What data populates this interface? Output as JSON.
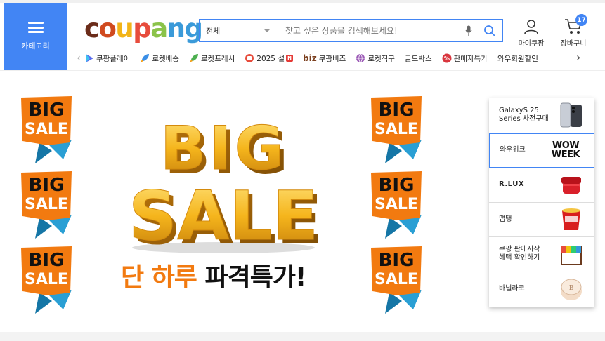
{
  "header": {
    "category_label": "카테고리",
    "logo": {
      "letters": [
        "c",
        "o",
        "u",
        "p",
        "a",
        "n",
        "g"
      ],
      "colors": [
        "#6b2c1a",
        "#d04a1f",
        "#f2b418",
        "#e74c3c",
        "#8bc34a",
        "#3a9ad9",
        "#3a9ad9"
      ]
    },
    "search": {
      "category": "전체",
      "placeholder": "찾고 싶은 상품을 검색해보세요!"
    },
    "my_coupang": "마이쿠팡",
    "cart": {
      "label": "장바구니",
      "count": "17"
    }
  },
  "nav": {
    "items": [
      {
        "label": "쿠팡플레이",
        "icon": "play-icon"
      },
      {
        "label": "로켓배송",
        "icon": "rocket-icon"
      },
      {
        "label": "로켓프레시",
        "icon": "fresh-rocket-icon"
      },
      {
        "label": "2025 설",
        "icon": "gift-icon",
        "badge": "N"
      },
      {
        "label": "쿠팡비즈",
        "icon": "biz-icon",
        "prefix": "biz"
      },
      {
        "label": "로켓직구",
        "icon": "globe-icon"
      },
      {
        "label": "골드박스",
        "icon": ""
      },
      {
        "label": "판매자특가",
        "icon": "percent-icon"
      },
      {
        "label": "와우회원할인",
        "icon": ""
      }
    ]
  },
  "banner": {
    "badge_text_1": "BIG",
    "badge_text_2": "SALE",
    "hero_top": "BIG",
    "hero_bottom": "SALE",
    "headline_orange": "단 하루",
    "headline_black": "파격특가!"
  },
  "side_panel": {
    "items": [
      {
        "label": "GalaxyS 25\nSeries 사전구매",
        "thumb": "phone-thumb"
      },
      {
        "label": "와우위크",
        "thumb": "wow-week-thumb",
        "thumb_text": "WOW\nWEEK"
      },
      {
        "label": "R.LUX",
        "thumb": "cosmetic-jar-thumb"
      },
      {
        "label": "맵탱",
        "thumb": "ramen-cup-thumb"
      },
      {
        "label": "쿠팡 판매시작\n혜택 확인하기",
        "thumb": "store-thumb"
      },
      {
        "label": "바닐라코",
        "thumb": "cushion-compact-thumb"
      }
    ]
  }
}
